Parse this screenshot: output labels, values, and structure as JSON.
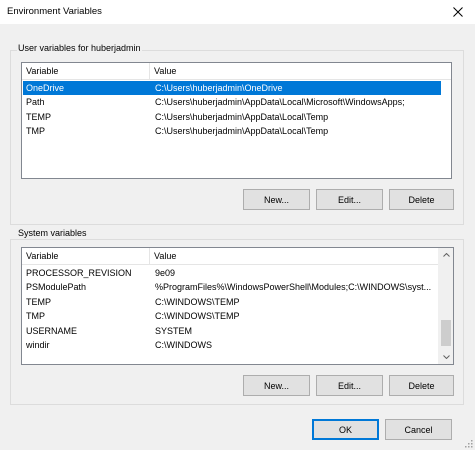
{
  "window": {
    "title": "Environment Variables"
  },
  "user_vars": {
    "label": "User variables for huberjadmin",
    "columns": [
      "Variable",
      "Value"
    ],
    "rows": [
      {
        "name": "OneDrive",
        "value": "C:\\Users\\huberjadmin\\OneDrive",
        "selected": true
      },
      {
        "name": "Path",
        "value": "C:\\Users\\huberjadmin\\AppData\\Local\\Microsoft\\WindowsApps;",
        "selected": false
      },
      {
        "name": "TEMP",
        "value": "C:\\Users\\huberjadmin\\AppData\\Local\\Temp",
        "selected": false
      },
      {
        "name": "TMP",
        "value": "C:\\Users\\huberjadmin\\AppData\\Local\\Temp",
        "selected": false
      }
    ],
    "buttons": {
      "new": "New...",
      "edit": "Edit...",
      "delete": "Delete"
    }
  },
  "system_vars": {
    "label": "System variables",
    "columns": [
      "Variable",
      "Value"
    ],
    "rows": [
      {
        "name": "PROCESSOR_REVISION",
        "value": "9e09"
      },
      {
        "name": "PSModulePath",
        "value": "%ProgramFiles%\\WindowsPowerShell\\Modules;C:\\WINDOWS\\syst..."
      },
      {
        "name": "TEMP",
        "value": "C:\\WINDOWS\\TEMP"
      },
      {
        "name": "TMP",
        "value": "C:\\WINDOWS\\TEMP"
      },
      {
        "name": "USERNAME",
        "value": "SYSTEM"
      },
      {
        "name": "windir",
        "value": "C:\\WINDOWS"
      }
    ],
    "buttons": {
      "new": "New...",
      "edit": "Edit...",
      "delete": "Delete"
    }
  },
  "footer": {
    "ok": "OK",
    "cancel": "Cancel"
  },
  "icons": {
    "close": "close-icon",
    "scroll_up": "chevron-up-icon",
    "scroll_down": "chevron-down-icon",
    "grip": "resize-grip-icon"
  },
  "colors": {
    "selection": "#0078d7",
    "face": "#f0f0f0"
  }
}
